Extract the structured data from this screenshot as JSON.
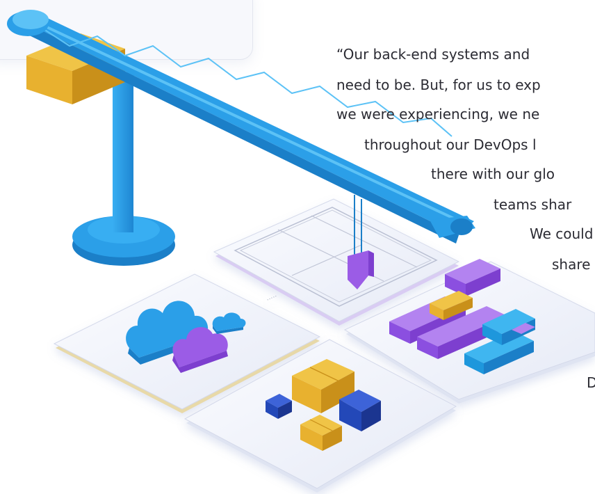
{
  "quote": {
    "lines": [
      "“Our back-end systems and",
      "need to be. But, for us to exp",
      "we were experiencing, we ne",
      "throughout our DevOps l",
      "there with our glo",
      "teams shar",
      "We could",
      "share"
    ],
    "attribution_fragment": "D"
  },
  "illustration": {
    "subject": "crane lowering a block onto tiles with clouds, boxes and bricks",
    "colors": {
      "crane": "#2b9fe8",
      "crane_dark": "#1b7fc8",
      "box": "#e8b12f",
      "box_dark": "#c9901a",
      "purple": "#9b5ce6",
      "navy": "#2348b8",
      "tile": "#eef1f9"
    },
    "panel_ticks": "....."
  }
}
